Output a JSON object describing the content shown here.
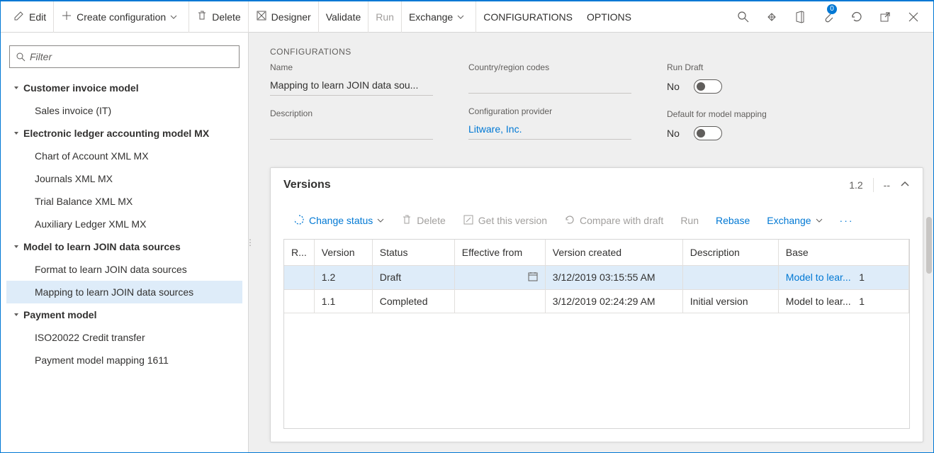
{
  "toolbar": {
    "edit": "Edit",
    "create_config": "Create configuration",
    "delete": "Delete",
    "designer": "Designer",
    "validate": "Validate",
    "run": "Run",
    "exchange": "Exchange",
    "configurations": "CONFIGURATIONS",
    "options": "OPTIONS",
    "attach_badge": "0"
  },
  "filter": {
    "placeholder": "Filter"
  },
  "tree": [
    {
      "type": "parent",
      "label": "Customer invoice model"
    },
    {
      "type": "child",
      "label": "Sales invoice (IT)"
    },
    {
      "type": "parent",
      "label": "Electronic ledger accounting model MX"
    },
    {
      "type": "child",
      "label": "Chart of Account XML MX"
    },
    {
      "type": "child",
      "label": "Journals XML MX"
    },
    {
      "type": "child",
      "label": "Trial Balance XML MX"
    },
    {
      "type": "child",
      "label": "Auxiliary Ledger XML MX"
    },
    {
      "type": "parent",
      "label": "Model to learn JOIN data sources"
    },
    {
      "type": "child",
      "label": "Format to learn JOIN data sources"
    },
    {
      "type": "child",
      "label": "Mapping to learn JOIN data sources",
      "selected": true
    },
    {
      "type": "parent",
      "label": "Payment model"
    },
    {
      "type": "child",
      "label": "ISO20022 Credit transfer"
    },
    {
      "type": "child",
      "label": "Payment model mapping 1611"
    }
  ],
  "details": {
    "section_title": "CONFIGURATIONS",
    "name_label": "Name",
    "name_value": "Mapping to learn JOIN data sou...",
    "description_label": "Description",
    "description_value": "",
    "country_label": "Country/region codes",
    "country_value": "",
    "provider_label": "Configuration provider",
    "provider_value": "Litware, Inc.",
    "run_draft_label": "Run Draft",
    "run_draft_value": "No",
    "default_mapping_label": "Default for model mapping",
    "default_mapping_value": "No"
  },
  "versions": {
    "title": "Versions",
    "header_current": "1.2",
    "header_dashes": "--",
    "toolbar": {
      "change_status": "Change status",
      "delete": "Delete",
      "get_version": "Get this version",
      "compare": "Compare with draft",
      "run": "Run",
      "rebase": "Rebase",
      "exchange": "Exchange"
    },
    "columns": {
      "reviewed": "R...",
      "version": "Version",
      "status": "Status",
      "effective": "Effective from",
      "created": "Version created",
      "description": "Description",
      "base": "Base"
    },
    "rows": [
      {
        "version": "1.2",
        "status": "Draft",
        "effective": "",
        "created": "3/12/2019 03:15:55 AM",
        "description": "",
        "base": "Model to lear...",
        "base_ver": "1",
        "selected": true
      },
      {
        "version": "1.1",
        "status": "Completed",
        "effective": "",
        "created": "3/12/2019 02:24:29 AM",
        "description": "Initial version",
        "base": "Model to lear...",
        "base_ver": "1",
        "selected": false
      }
    ]
  }
}
